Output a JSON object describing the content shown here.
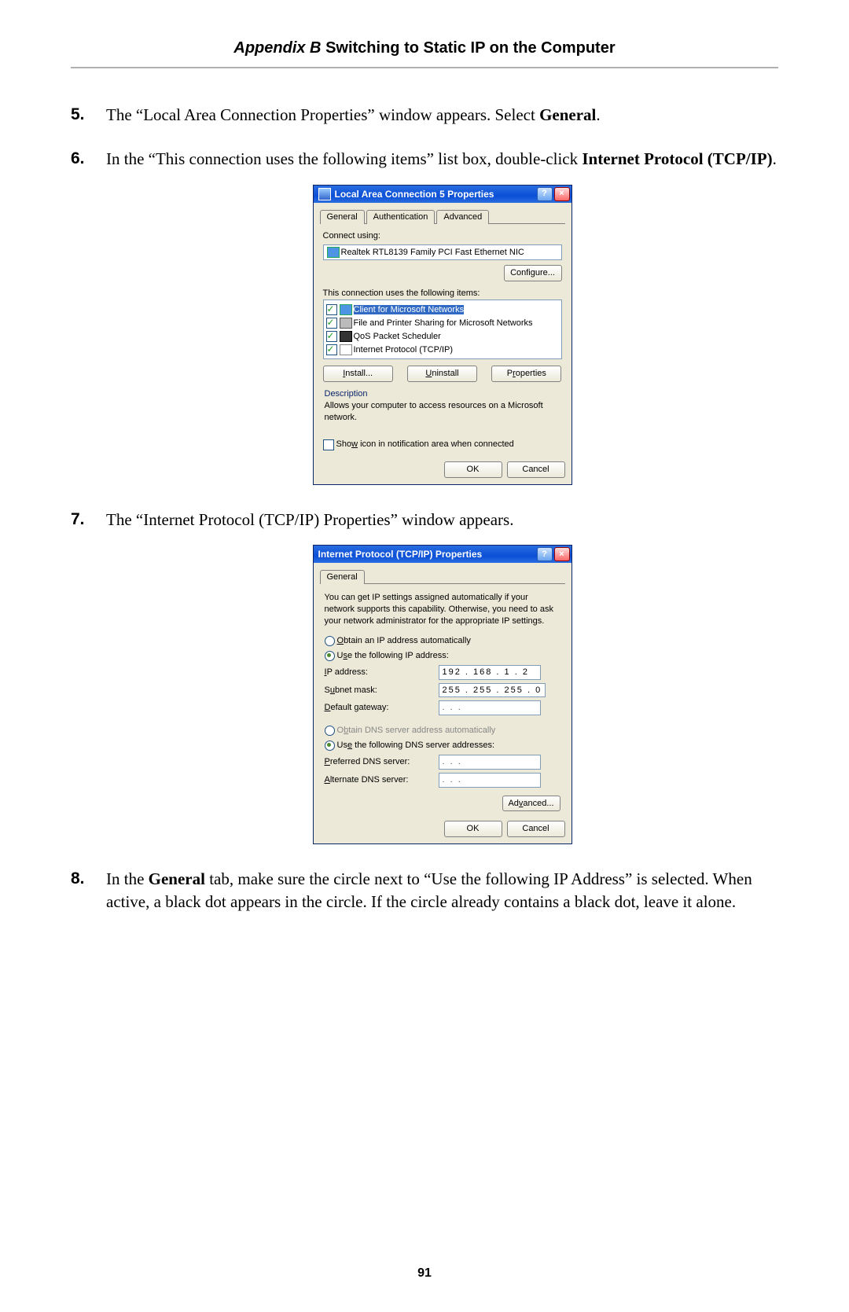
{
  "header": {
    "appendix": "Appendix B",
    "title": " Switching to Static IP on the Computer"
  },
  "page_number": "91",
  "steps": {
    "s5": {
      "num": "5.",
      "t1": "The “Local Area Connection Properties” window appears. Select ",
      "bold": "General",
      "t2": "."
    },
    "s6": {
      "num": "6.",
      "t1": "In the “This connection uses the following items” list box, double-click ",
      "bold": "Internet Protocol (TCP/IP)",
      "t2": "."
    },
    "s7": {
      "num": "7.",
      "t1": "The “Internet Protocol (",
      "sc": "TCP/IP",
      "t2": ") Properties” window appears."
    },
    "s8": {
      "num": "8.",
      "t1": "In the ",
      "bold": "General",
      "t2": " tab, make sure the circle next to “Use the following ",
      "sc": "IP",
      "t3": " Address” is selected. When active, a black dot appears in the circle. If the circle already contains a black dot, leave it alone."
    }
  },
  "dlg1": {
    "title": "Local Area Connection 5 Properties",
    "tabs": {
      "general": "General",
      "auth": "Authentication",
      "adv": "Advanced"
    },
    "connect_using": "Connect using:",
    "adapter": "Realtek RTL8139 Family PCI Fast Ethernet NIC",
    "configure": "Configure...",
    "items_label": "This connection uses the following items:",
    "items": {
      "a": "Client for Microsoft Networks",
      "b": "File and Printer Sharing for Microsoft Networks",
      "c": "QoS Packet Scheduler",
      "d": "Internet Protocol (TCP/IP)"
    },
    "install": "Install...",
    "uninstall": "Uninstall",
    "properties": "Properties",
    "desc_h": "Description",
    "desc": "Allows your computer to access resources on a Microsoft network.",
    "show_icon": "Show icon in notification area when connected",
    "ok": "OK",
    "cancel": "Cancel"
  },
  "dlg2": {
    "title": "Internet Protocol (TCP/IP) Properties",
    "tab": "General",
    "blurb": "You can get IP settings assigned automatically if your network supports this capability. Otherwise, you need to ask your network administrator for the appropriate IP settings.",
    "r1": "Obtain an IP address automatically",
    "r2": "Use the following IP address:",
    "ip_l": "IP address:",
    "ip_v": "192 . 168 .  1  .  2",
    "mask_l": "Subnet mask:",
    "mask_v": "255 . 255 . 255 .  0",
    "gw_l": "Default gateway:",
    "gw_v": " .        .        . ",
    "r3": "Obtain DNS server address automatically",
    "r4": "Use the following DNS server addresses:",
    "dns1_l": "Preferred DNS server:",
    "dns1_v": " .        .        . ",
    "dns2_l": "Alternate DNS server:",
    "dns2_v": " .        .        . ",
    "adv": "Advanced...",
    "ok": "OK",
    "cancel": "Cancel"
  }
}
